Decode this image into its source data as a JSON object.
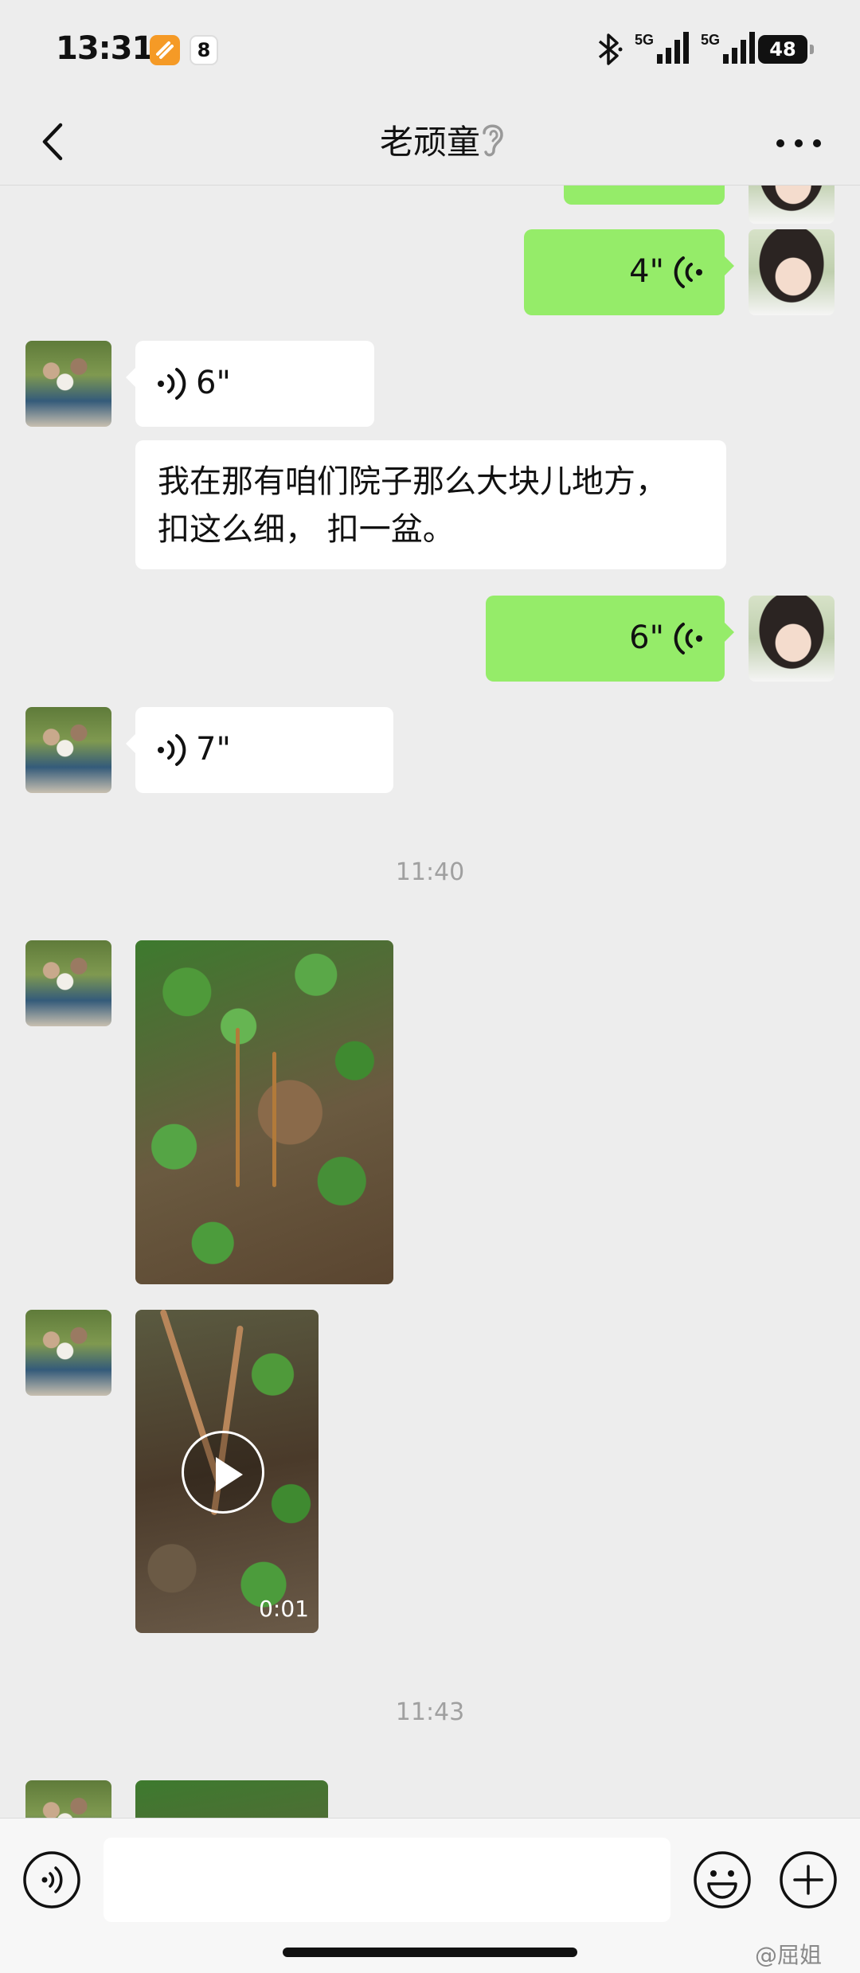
{
  "status_bar": {
    "time": "13:31",
    "badge2_text": "8",
    "signal1": "5G",
    "signal2": "5G",
    "battery": "48"
  },
  "header": {
    "title": "老顽童"
  },
  "messages": {
    "partial_top": {
      "direction": "out",
      "type": "text"
    },
    "voice1": {
      "direction": "out",
      "duration": "4\""
    },
    "voice2": {
      "direction": "in",
      "duration": "6\""
    },
    "text1": {
      "direction": "in",
      "text_line1": "我在那有咱们院子那么大块儿地方，",
      "text_line2": "扣这么细， 扣一盆。"
    },
    "voice3": {
      "direction": "out",
      "duration": "6\""
    },
    "voice4": {
      "direction": "in",
      "duration": "7\""
    },
    "timestamp1": "11:40",
    "image1": {
      "direction": "in",
      "type": "image"
    },
    "video1": {
      "direction": "in",
      "type": "video",
      "duration": "0:01"
    },
    "timestamp2": "11:43",
    "image2": {
      "direction": "in",
      "type": "image"
    }
  },
  "input_bar": {
    "input_value": "",
    "watermark": "@屈姐"
  },
  "colors": {
    "outgoing_bubble": "#95ec69",
    "incoming_bubble": "#ffffff",
    "background": "#ededed"
  }
}
